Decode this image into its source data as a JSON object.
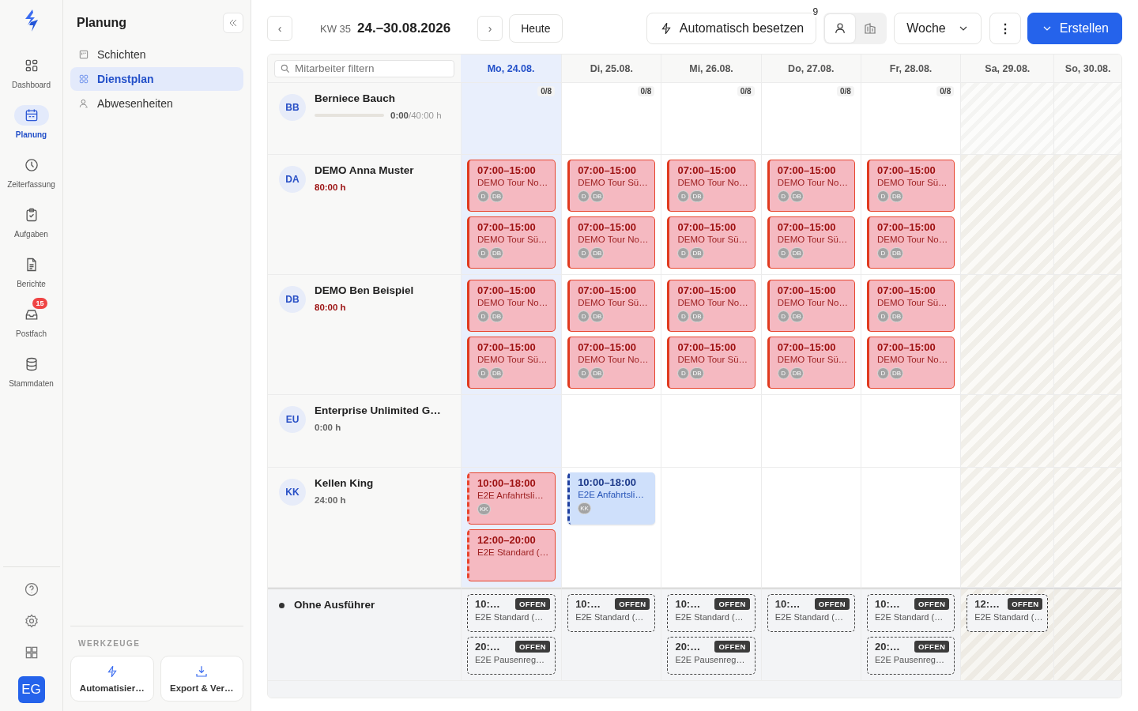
{
  "rail": {
    "items": [
      {
        "label": "Dashboard",
        "selected": false
      },
      {
        "label": "Planung",
        "selected": true
      },
      {
        "label": "Zeiterfassung",
        "selected": false
      },
      {
        "label": "Aufgaben",
        "selected": false
      },
      {
        "label": "Berichte",
        "selected": false
      },
      {
        "label": "Postfach",
        "selected": false,
        "badge": "15"
      },
      {
        "label": "Stammdaten",
        "selected": false
      }
    ],
    "user": "EG"
  },
  "subnav": {
    "title": "Planung",
    "items": [
      {
        "label": "Schichten",
        "selected": false
      },
      {
        "label": "Dienstplan",
        "selected": true
      },
      {
        "label": "Abwesenheiten",
        "selected": false
      }
    ],
    "section": "WERKZEUGE",
    "tools": [
      "Automatisier…",
      "Export & Ver…"
    ]
  },
  "toolbar": {
    "prev": "‹",
    "week": "KW 35",
    "range": "24.–30.08.2026",
    "next": "›",
    "today": "Heute",
    "auto": "Automatisch besetzen",
    "auto_badge": "9",
    "views": [
      {
        "selected": true
      },
      {
        "selected": false
      }
    ],
    "period": "Woche",
    "more": "⋮",
    "create": "Erstellen"
  },
  "search": {
    "placeholder": "Mitarbeiter filtern"
  },
  "days": [
    {
      "label": "Mo, 24.08.",
      "today": true,
      "weekend": false,
      "capacity": "0/8"
    },
    {
      "label": "Di, 25.08.",
      "today": false,
      "weekend": false,
      "capacity": "0/8"
    },
    {
      "label": "Mi, 26.08.",
      "today": false,
      "weekend": false,
      "capacity": "0/8"
    },
    {
      "label": "Do, 27.08.",
      "today": false,
      "weekend": false,
      "capacity": "0/8"
    },
    {
      "label": "Fr, 28.08.",
      "today": false,
      "weekend": false,
      "capacity": "0/8"
    },
    {
      "label": "Sa, 29.08.",
      "today": false,
      "weekend": true
    },
    {
      "label": "So, 30.08.",
      "today": false,
      "weekend": true
    }
  ],
  "employees": [
    {
      "initials": "BB",
      "name": "Berniece Bauch",
      "hours": "0:00",
      "target": "/40:00 h",
      "level": 0,
      "over": false
    },
    {
      "initials": "DA",
      "name": "DEMO Anna Muster",
      "hours": "80:00 h",
      "over": true,
      "shifts": [
        [
          {
            "time": "07:00–15:00",
            "title": "DEMO Tour No…",
            "avatars": [
              "D",
              "DB"
            ],
            "conflict": true,
            "dashed": false
          },
          {
            "time": "07:00–15:00",
            "title": "DEMO Tour Sü…",
            "avatars": [
              "D",
              "DB"
            ],
            "conflict": true,
            "dashed": false
          }
        ],
        [
          {
            "time": "07:00–15:00",
            "title": "DEMO Tour Sü…",
            "avatars": [
              "D",
              "DB"
            ],
            "conflict": true,
            "dashed": false
          },
          {
            "time": "07:00–15:00",
            "title": "DEMO Tour No…",
            "avatars": [
              "D",
              "DB"
            ],
            "conflict": true,
            "dashed": false
          }
        ],
        [
          {
            "time": "07:00–15:00",
            "title": "DEMO Tour No…",
            "avatars": [
              "D",
              "DB"
            ],
            "conflict": true,
            "dashed": false
          },
          {
            "time": "07:00–15:00",
            "title": "DEMO Tour Sü…",
            "avatars": [
              "D",
              "DB"
            ],
            "conflict": true,
            "dashed": false
          }
        ],
        [
          {
            "time": "07:00–15:00",
            "title": "DEMO Tour No…",
            "avatars": [
              "D",
              "DB"
            ],
            "conflict": true,
            "dashed": false
          },
          {
            "time": "07:00–15:00",
            "title": "DEMO Tour Sü…",
            "avatars": [
              "D",
              "DB"
            ],
            "conflict": true,
            "dashed": false
          }
        ],
        [
          {
            "time": "07:00–15:00",
            "title": "DEMO Tour Sü…",
            "avatars": [
              "D",
              "DB"
            ],
            "conflict": true,
            "dashed": false
          },
          {
            "time": "07:00–15:00",
            "title": "DEMO Tour No…",
            "avatars": [
              "D",
              "DB"
            ],
            "conflict": true,
            "dashed": false
          }
        ]
      ]
    },
    {
      "initials": "DB",
      "name": "DEMO Ben Beispiel",
      "hours": "80:00 h",
      "over": true,
      "shifts": [
        [
          {
            "time": "07:00–15:00",
            "title": "DEMO Tour No…",
            "avatars": [
              "D",
              "DB"
            ],
            "conflict": true,
            "dashed": false
          },
          {
            "time": "07:00–15:00",
            "title": "DEMO Tour Sü…",
            "avatars": [
              "D",
              "DB"
            ],
            "conflict": true,
            "dashed": false
          }
        ],
        [
          {
            "time": "07:00–15:00",
            "title": "DEMO Tour Sü…",
            "avatars": [
              "D",
              "DB"
            ],
            "conflict": true,
            "dashed": false
          },
          {
            "time": "07:00–15:00",
            "title": "DEMO Tour No…",
            "avatars": [
              "D",
              "DB"
            ],
            "conflict": true,
            "dashed": false
          }
        ],
        [
          {
            "time": "07:00–15:00",
            "title": "DEMO Tour No…",
            "avatars": [
              "D",
              "DB"
            ],
            "conflict": true,
            "dashed": false
          },
          {
            "time": "07:00–15:00",
            "title": "DEMO Tour Sü…",
            "avatars": [
              "D",
              "DB"
            ],
            "conflict": true,
            "dashed": false
          }
        ],
        [
          {
            "time": "07:00–15:00",
            "title": "DEMO Tour No…",
            "avatars": [
              "D",
              "DB"
            ],
            "conflict": true,
            "dashed": false
          },
          {
            "time": "07:00–15:00",
            "title": "DEMO Tour Sü…",
            "avatars": [
              "D",
              "DB"
            ],
            "conflict": true,
            "dashed": false
          }
        ],
        [
          {
            "time": "07:00–15:00",
            "title": "DEMO Tour Sü…",
            "avatars": [
              "D",
              "DB"
            ],
            "conflict": true,
            "dashed": false
          },
          {
            "time": "07:00–15:00",
            "title": "DEMO Tour No…",
            "avatars": [
              "D",
              "DB"
            ],
            "conflict": true,
            "dashed": false
          }
        ]
      ]
    },
    {
      "initials": "EU",
      "name": "Enterprise Unlimited G…",
      "hours": "0:00 h",
      "over": false
    },
    {
      "initials": "KK",
      "name": "Kellen King",
      "hours": "24:00 h",
      "over": false,
      "shifts": [
        [
          {
            "time": "10:00–18:00",
            "title": "E2E Anfahrtsli…",
            "avatars": [
              "KK"
            ],
            "conflict": true,
            "dashed": true
          },
          {
            "time": "12:00–20:00",
            "title": "E2E Standard (…",
            "conflict": true,
            "dashed": true
          }
        ],
        [
          {
            "time": "10:00–18:00",
            "title": "E2E Anfahrtsli…",
            "avatars": [
              "KK"
            ],
            "conflict": false,
            "dashed": true
          }
        ]
      ]
    }
  ],
  "unassigned": {
    "label": "Ohne Ausführer",
    "shifts": [
      [
        {
          "time": "10:…",
          "badge": "OFFEN",
          "title": "E2E Standard (…"
        },
        {
          "time": "20:…",
          "badge": "OFFEN",
          "title": "E2E Pausenreg…"
        }
      ],
      [
        {
          "time": "10:…",
          "badge": "OFFEN",
          "title": "E2E Standard (…"
        }
      ],
      [
        {
          "time": "10:…",
          "badge": "OFFEN",
          "title": "E2E Standard (…"
        },
        {
          "time": "20:…",
          "badge": "OFFEN",
          "title": "E2E Pausenreg…"
        }
      ],
      [
        {
          "time": "10:…",
          "badge": "OFFEN",
          "title": "E2E Standard (…"
        }
      ],
      [
        {
          "time": "10:…",
          "badge": "OFFEN",
          "title": "E2E Standard (…"
        },
        {
          "time": "20:…",
          "badge": "OFFEN",
          "title": "E2E Pausenreg…"
        }
      ],
      [
        {
          "time": "12:…",
          "badge": "OFFEN",
          "title": "E2E Standard (…"
        }
      ]
    ]
  }
}
